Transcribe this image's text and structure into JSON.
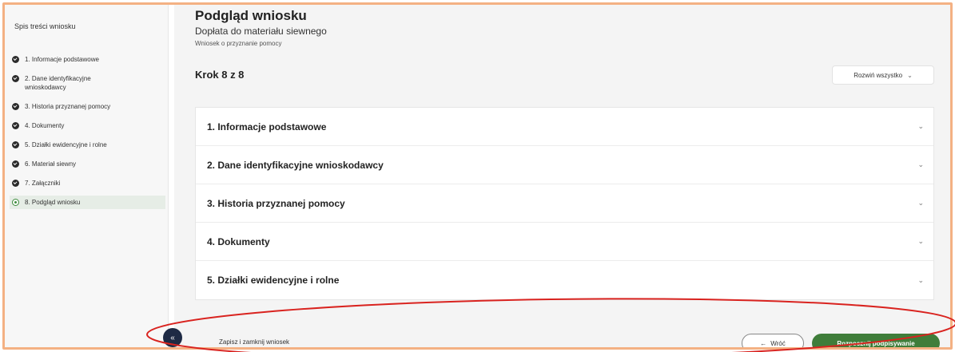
{
  "sidebar": {
    "title": "Spis treści wniosku",
    "steps": [
      {
        "label": "1. Informacje podstawowe"
      },
      {
        "label": "2. Dane identyfikacyjne wnioskodawcy"
      },
      {
        "label": "3. Historia przyznanej pomocy"
      },
      {
        "label": "4. Dokumenty"
      },
      {
        "label": "5. Działki ewidencyjne i rolne"
      },
      {
        "label": "6. Materiał siewny"
      },
      {
        "label": "7. Załączniki"
      },
      {
        "label": "8. Podgląd wniosku",
        "active": true
      }
    ]
  },
  "main": {
    "title": "Podgląd wniosku",
    "subtitle": "Dopłata do materiału siewnego",
    "caption": "Wniosek o przyznanie pomocy",
    "step_counter": "Krok 8 z 8",
    "expand_all_label": "Rozwiń wszystko",
    "sections": [
      {
        "label": "1. Informacje podstawowe"
      },
      {
        "label": "2. Dane identyfikacyjne wnioskodawcy"
      },
      {
        "label": "3. Historia przyznanej pomocy"
      },
      {
        "label": "4. Dokumenty"
      },
      {
        "label": "5. Działki ewidencyjne i rolne"
      }
    ]
  },
  "footer": {
    "collapse_glyph": "«",
    "save_close_label": "Zapisz i zamknij wniosek",
    "back_label": "Wróć",
    "back_arrow": "←",
    "sign_label": "Rozpocznij podpisywanie"
  },
  "colors": {
    "frame_border": "#f4b183",
    "primary_green": "#3f7d3a",
    "collapse_button": "#1e2a44",
    "annotation_ellipse": "#d9231f"
  },
  "icons": {
    "step_done": "check-circle-icon",
    "step_current": "radio-current-icon",
    "expand": "chevron-down-icon",
    "collapse": "double-chevron-left-icon",
    "back": "arrow-left-icon"
  }
}
